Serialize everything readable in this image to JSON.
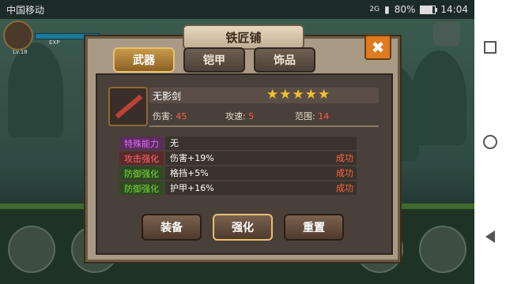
{
  "status_bar": {
    "carrier": "中国移动",
    "network": "2G",
    "battery": "80%",
    "time": "14:04"
  },
  "hud": {
    "level": "Lv.18",
    "exp_label": "EXP"
  },
  "dialog": {
    "title": "铁匠铺",
    "close_label": "✖",
    "tabs": [
      {
        "label": "武器",
        "active": true
      },
      {
        "label": "铠甲",
        "active": false
      },
      {
        "label": "饰品",
        "active": false
      }
    ],
    "item": {
      "name": "无影剑",
      "stars": 5,
      "stats": [
        {
          "label": "伤害:",
          "value": "45"
        },
        {
          "label": "攻速:",
          "value": "5"
        },
        {
          "label": "范围:",
          "value": "14"
        }
      ]
    },
    "attributes": [
      {
        "label": "特殊能力",
        "value": "无",
        "result": "",
        "label_color": "#e06aff"
      },
      {
        "label": "攻击强化",
        "value": "伤害+19%",
        "result": "成功",
        "label_color": "#ff6a6a"
      },
      {
        "label": "防御强化",
        "value": "格挡+5%",
        "result": "成功",
        "label_color": "#7adc3a"
      },
      {
        "label": "防御强化",
        "value": "护甲+16%",
        "result": "成功",
        "label_color": "#7adc3a"
      }
    ],
    "buttons": [
      {
        "label": "装备",
        "selected": false
      },
      {
        "label": "强化",
        "selected": true
      },
      {
        "label": "重置",
        "selected": false
      }
    ]
  }
}
